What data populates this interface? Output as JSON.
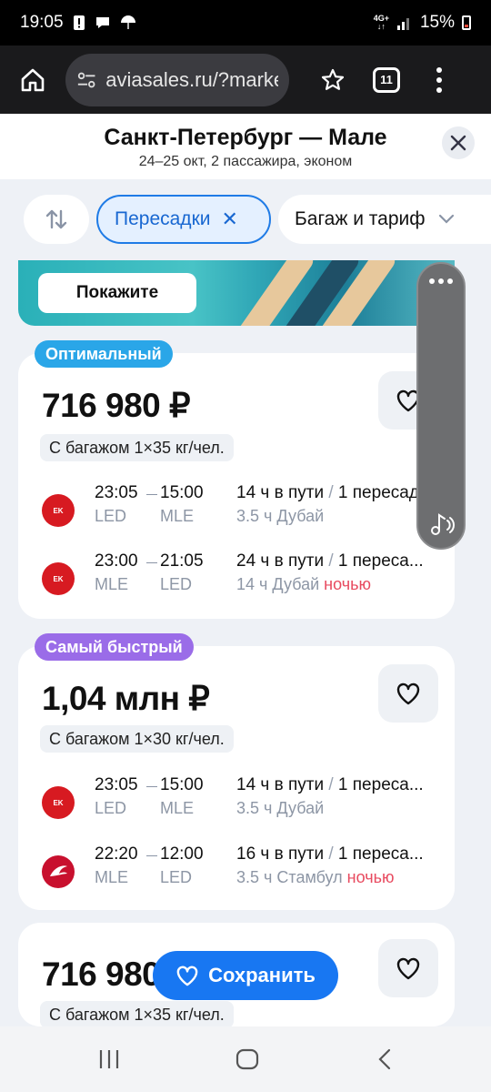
{
  "status_bar": {
    "time": "19:05",
    "network": "4G+",
    "battery_percent": "15%"
  },
  "browser": {
    "url": "aviasales.ru/?marker",
    "tab_count": "11"
  },
  "route": {
    "title": "Санкт-Петербург — Мале",
    "subtitle": "24–25 окт, 2 пассажира, эконом"
  },
  "filters": {
    "stops_label": "Пересадки",
    "baggage_label": "Багаж и тариф"
  },
  "banner": {
    "button_label": "Покажите"
  },
  "cards": [
    {
      "badge": "Оптимальный",
      "price": "716 980 ₽",
      "baggage": "С багажом 1×35 кг/чел.",
      "segments": [
        {
          "airline": "Emirates",
          "dep_time": "23:05",
          "arr_time": "15:00",
          "dep_code": "LED",
          "arr_code": "MLE",
          "duration": "14 ч в пути",
          "stops": "1 пересадка",
          "layover": "3.5 ч Дубай",
          "night": ""
        },
        {
          "airline": "Emirates",
          "dep_time": "23:00",
          "arr_time": "21:05",
          "dep_code": "MLE",
          "arr_code": "LED",
          "duration": "24 ч в пути",
          "stops": "1 переса...",
          "layover": "14 ч Дубай",
          "night": "ночью"
        }
      ]
    },
    {
      "badge": "Самый быстрый",
      "price": "1,04 млн ₽",
      "baggage": "С багажом 1×30 кг/чел.",
      "segments": [
        {
          "airline": "Emirates",
          "dep_time": "23:05",
          "arr_time": "15:00",
          "dep_code": "LED",
          "arr_code": "MLE",
          "duration": "14 ч в пути",
          "stops": "1 переса...",
          "layover": "3.5 ч Дубай",
          "night": ""
        },
        {
          "airline": "Turkish Airlines",
          "dep_time": "22:20",
          "arr_time": "12:00",
          "dep_code": "MLE",
          "arr_code": "LED",
          "duration": "16 ч в пути",
          "stops": "1 переса...",
          "layover": "3.5 ч Стамбул",
          "night": "ночью"
        }
      ]
    },
    {
      "badge": "",
      "price": "716 980",
      "baggage": "С багажом 1×35 кг/чел.",
      "segments": []
    }
  ],
  "save_button": {
    "label": "Сохранить"
  },
  "colors": {
    "accent": "#1877f2",
    "optimal_badge": "#2aa6e8",
    "fastest_badge": "#9a6ce8",
    "night": "#e84a5f"
  }
}
